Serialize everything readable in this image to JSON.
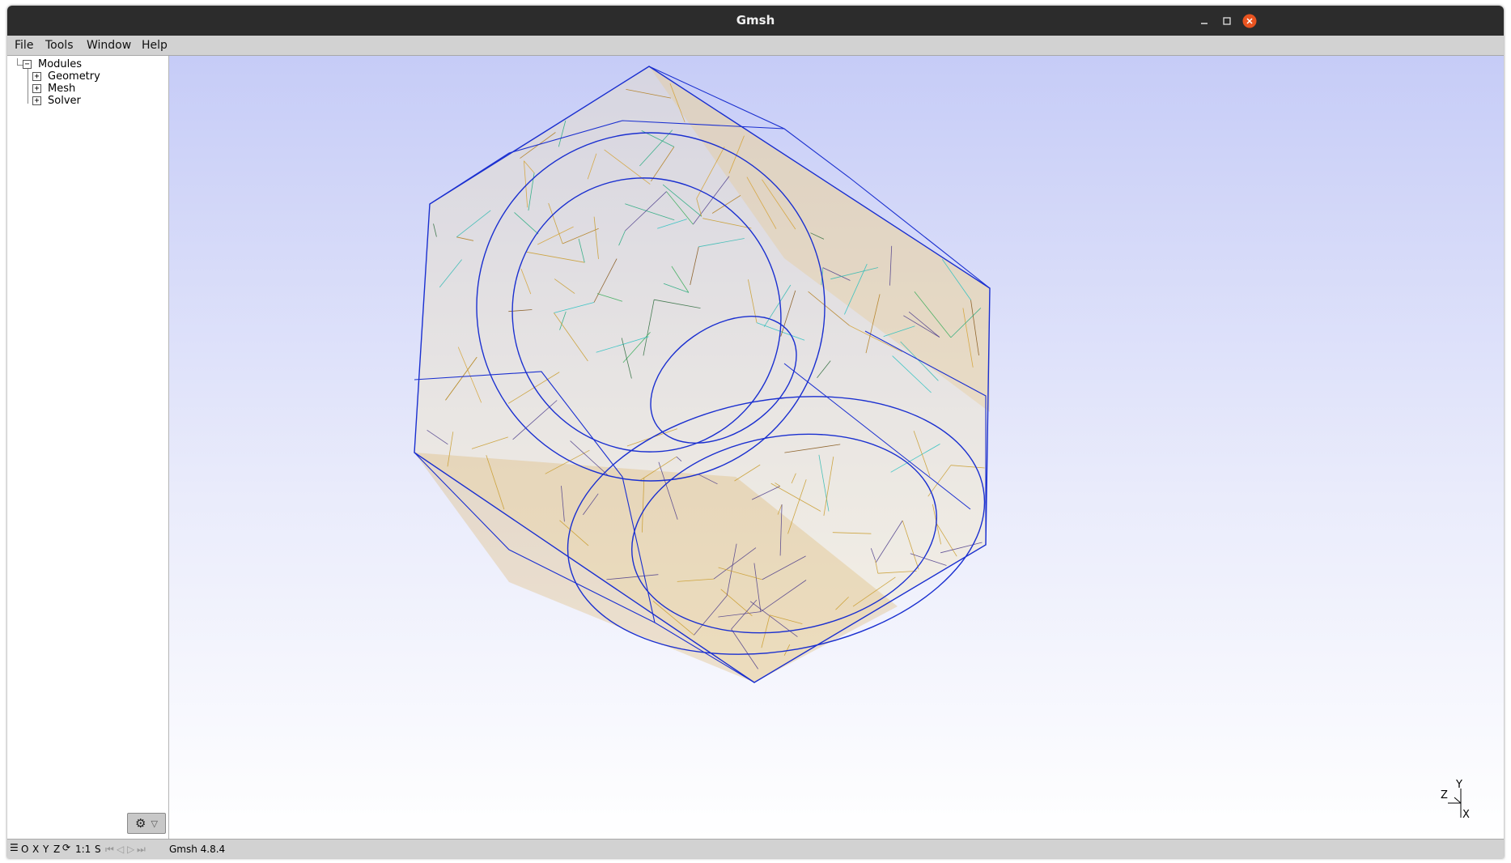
{
  "window": {
    "title": "Gmsh"
  },
  "menu": [
    "File",
    "Tools",
    "Window",
    "Help"
  ],
  "tree": {
    "root": "Modules",
    "children": [
      "Geometry",
      "Mesh",
      "Solver"
    ]
  },
  "axes": {
    "y": "Y",
    "z": "Z",
    "x": "X"
  },
  "statusbar": {
    "view_o": "O",
    "view_x": "X",
    "view_y": "Y",
    "view_z": "Z",
    "scale": "1:1",
    "scale_s": "S",
    "message": "Gmsh 4.8.4"
  },
  "colors": {
    "titlebar": "#2c2c2c",
    "close_button": "#e95420",
    "mesh_edges": "#1a2fd0",
    "background_top": "#c6ccf7",
    "background_bottom": "#ffffff"
  },
  "icons": [
    "minimize-icon",
    "maximize-icon",
    "close-icon",
    "gear-icon",
    "dropdown-triangle-icon",
    "rotate-icon",
    "first-icon",
    "previous-icon",
    "play-icon",
    "next-icon",
    "last-icon",
    "menu-lines-icon"
  ]
}
